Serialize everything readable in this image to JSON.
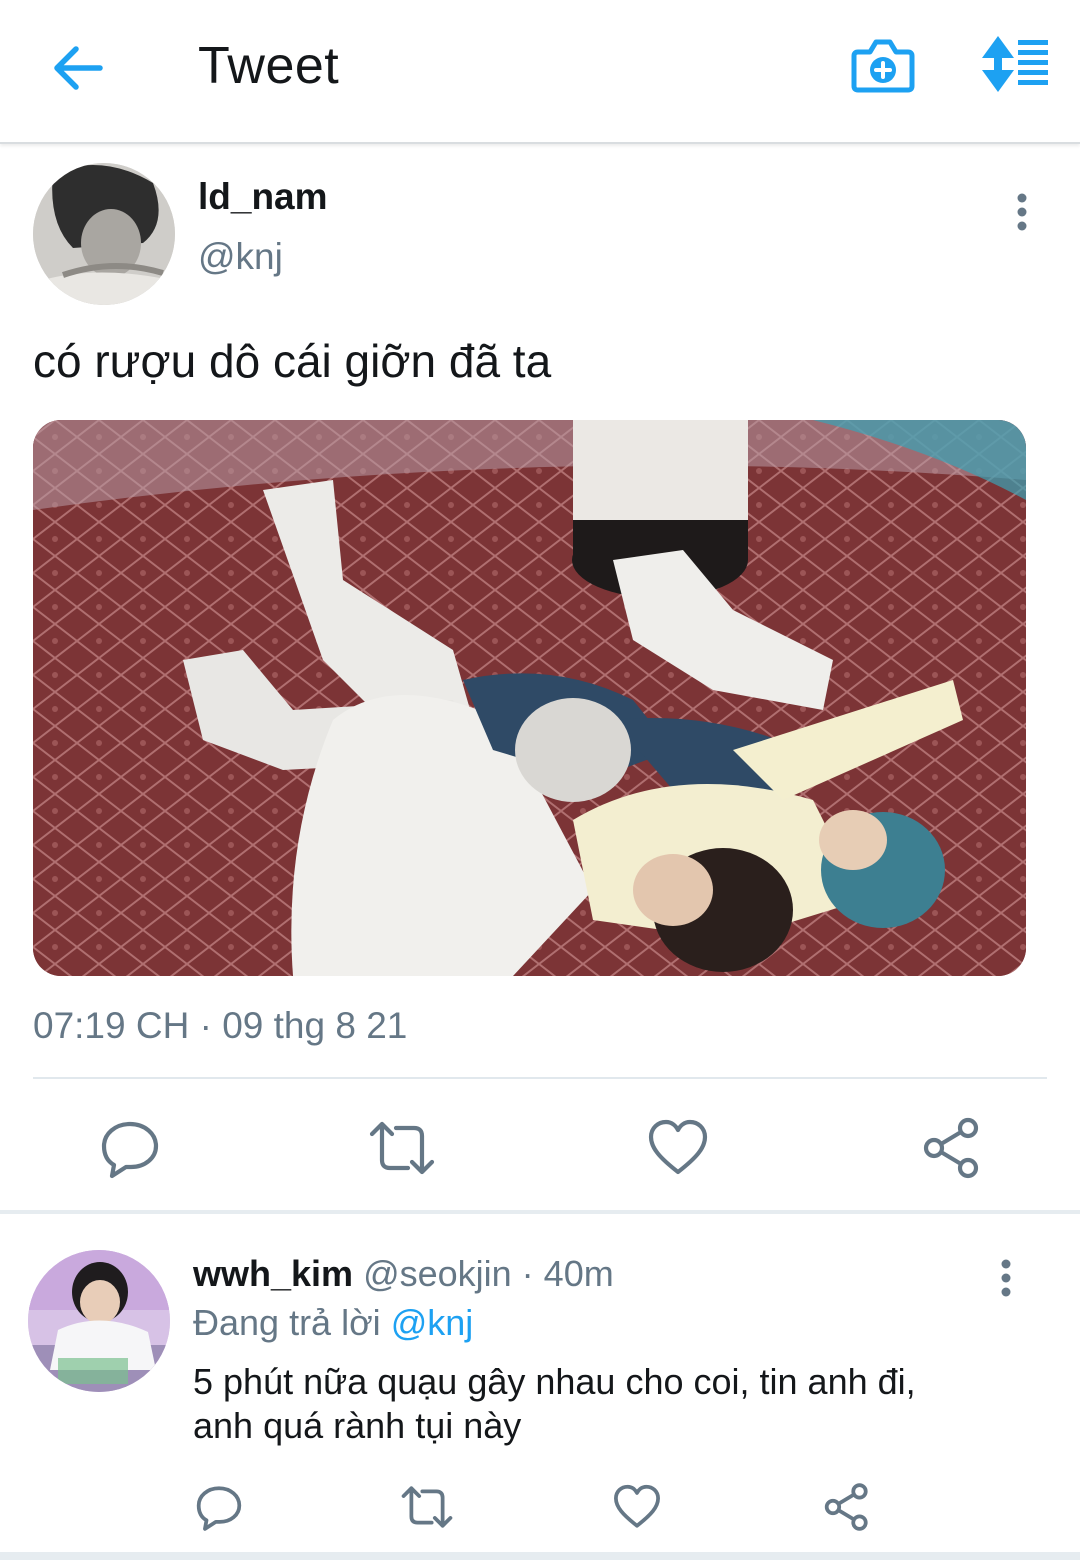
{
  "header": {
    "title": "Tweet",
    "accent": "#1da1f2",
    "icons": {
      "back": "arrow-left-icon",
      "camera": "camera-plus-icon",
      "sort": "sort-icon"
    }
  },
  "tweet": {
    "display_name": "ld_nam",
    "handle": "@knj",
    "text": "có rượu dô cái giỡn đã ta",
    "timestamp": "07:19 CH · 09 thg 8 21",
    "actions": [
      "reply-icon",
      "retweet-icon",
      "like-icon",
      "share-icon"
    ]
  },
  "reply": {
    "display_name": "wwh_kim",
    "meta": "@seokjin · 40m",
    "replying_prefix": "Đang trả lời",
    "replying_to": "@knj",
    "text_line1": "5 phút nữa quạu gây nhau cho coi, tin anh đi,",
    "text_line2": "anh quá rành tụi này",
    "actions": [
      "reply-icon",
      "retweet-icon",
      "like-icon",
      "share-icon"
    ]
  },
  "colors": {
    "secondary_text": "#657786",
    "icon_gray": "#657786",
    "divider": "#e1e8ed"
  }
}
